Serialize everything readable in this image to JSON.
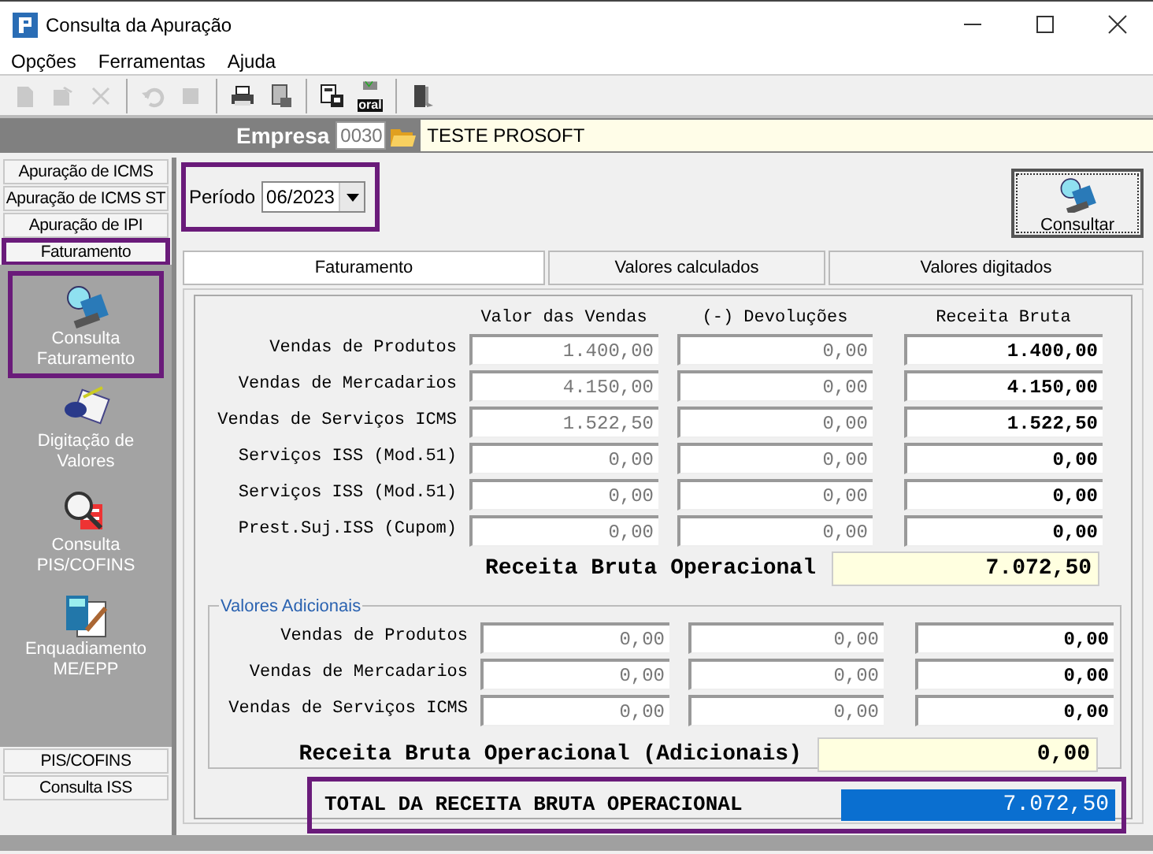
{
  "window": {
    "title": "Consulta da Apuração"
  },
  "menu": [
    "Opções",
    "Ferramentas",
    "Ajuda"
  ],
  "toolbar": [
    {
      "kind": "new",
      "disabled": true
    },
    {
      "kind": "edit",
      "disabled": true
    },
    {
      "kind": "delete",
      "disabled": true
    },
    {
      "kind": "sep"
    },
    {
      "kind": "undo",
      "disabled": true
    },
    {
      "kind": "stop",
      "disabled": true
    },
    {
      "kind": "sep"
    },
    {
      "kind": "print",
      "disabled": false
    },
    {
      "kind": "preview",
      "disabled": false
    },
    {
      "kind": "sep"
    },
    {
      "kind": "export",
      "disabled": false
    },
    {
      "kind": "oral",
      "disabled": false,
      "caption": "oral"
    },
    {
      "kind": "sep"
    },
    {
      "kind": "exit",
      "disabled": false
    }
  ],
  "company": {
    "label": "Empresa",
    "code": "0030",
    "name": "TESTE PROSOFT"
  },
  "sidebar": {
    "top_tabs": [
      {
        "label": "Apuração de ICMS",
        "highlighted": false
      },
      {
        "label": "Apuração de ICMS ST",
        "highlighted": false
      },
      {
        "label": "Apuração de IPI",
        "highlighted": false
      },
      {
        "label": "Faturamento",
        "highlighted": true
      }
    ],
    "items": [
      {
        "kind": "consult",
        "label": "Consulta Faturamento",
        "highlighted": true
      },
      {
        "kind": "typing",
        "label": "Digitação de Valores",
        "highlighted": false
      },
      {
        "kind": "search",
        "label": "Consulta PIS/COFINS",
        "highlighted": false
      },
      {
        "kind": "calc",
        "label": "Enquadiamento ME/EPP",
        "highlighted": false
      }
    ],
    "bottom_tabs": [
      {
        "label": "PIS/COFINS",
        "highlighted": false
      },
      {
        "label": "Consulta ISS",
        "highlighted": false
      }
    ]
  },
  "period": {
    "label": "Período",
    "value": "06/2023",
    "highlighted": true
  },
  "consult_button": "Consultar",
  "tabs": [
    {
      "label": "Faturamento",
      "selected": true
    },
    {
      "label": "Valores calculados",
      "selected": false
    },
    {
      "label": "Valores digitados",
      "selected": false
    }
  ],
  "columns": [
    "Valor das Vendas",
    "(-) Devoluções",
    "Receita Bruta"
  ],
  "rows": [
    {
      "label": "Vendas de Produtos",
      "values": [
        "1.400,00",
        "0,00",
        "1.400,00"
      ]
    },
    {
      "label": "Vendas de Mercadarios",
      "values": [
        "4.150,00",
        "0,00",
        "4.150,00"
      ]
    },
    {
      "label": "Vendas de Serviços ICMS",
      "values": [
        "1.522,50",
        "0,00",
        "1.522,50"
      ]
    },
    {
      "label": "Serviços ISS (Mod.51)",
      "values": [
        "0,00",
        "0,00",
        "0,00"
      ]
    },
    {
      "label": "Serviços ISS (Mod.51)",
      "values": [
        "0,00",
        "0,00",
        "0,00"
      ]
    },
    {
      "label": "Prest.Suj.ISS (Cupom)",
      "values": [
        "0,00",
        "0,00",
        "0,00"
      ]
    }
  ],
  "subtotal": {
    "label": "Receita Bruta Operacional",
    "value": "7.072,50"
  },
  "additional": {
    "title": "Valores Adicionais",
    "rows": [
      {
        "label": "Vendas de Produtos",
        "values": [
          "0,00",
          "0,00",
          "0,00"
        ]
      },
      {
        "label": "Vendas de Mercadarios",
        "values": [
          "0,00",
          "0,00",
          "0,00"
        ]
      },
      {
        "label": "Vendas de Serviços ICMS",
        "values": [
          "0,00",
          "0,00",
          "0,00"
        ]
      }
    ],
    "subtotal": {
      "label": "Receita Bruta Operacional (Adicionais)",
      "value": "0,00"
    }
  },
  "total": {
    "label": "TOTAL DA RECEITA BRUTA OPERACIONAL",
    "value": "7.072,50",
    "highlighted": true
  }
}
